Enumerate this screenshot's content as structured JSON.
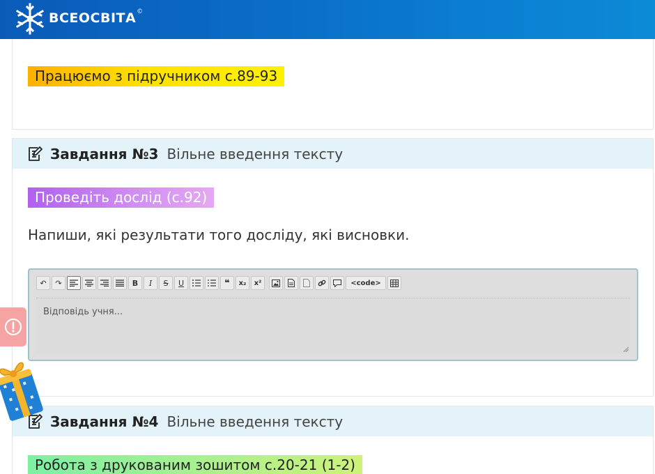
{
  "header": {
    "brand": "ВСЕОСВІТА",
    "copyright": "©",
    "logo_icon": "snowflake-icon"
  },
  "section_top": {
    "highlight": "Працюємо з підручником с.89-93"
  },
  "task3": {
    "number": "Завдання №3",
    "type": "Вільне введення тексту",
    "icon": "edit-note-icon",
    "highlight": "Проведіть дослід (с.92)",
    "text": "Напиши, які результати того досліду, які висновки.",
    "editor": {
      "placeholder": "Відповідь учня...",
      "toolbar": [
        "undo",
        "redo",
        "align-left",
        "align-center",
        "align-right",
        "justify",
        "bold",
        "italic",
        "strikethrough",
        "underline",
        "bullet-list",
        "numbered-list",
        "quote",
        "subscript",
        "superscript",
        "image",
        "file",
        "document",
        "link",
        "comment",
        "code",
        "table"
      ],
      "bold_label": "B",
      "italic_label": "I",
      "strike_label": "S",
      "underline_label": "U",
      "quote_label": "❝",
      "sub_label": "x₂",
      "sup_label": "x²",
      "code_label": "<code>"
    }
  },
  "task4": {
    "number": "Завдання №4",
    "type": "Вільне введення тексту",
    "icon": "edit-note-icon",
    "highlight": "Робота з друкованим зошитом с.20-21 (1-2)"
  },
  "side": {
    "alert_icon": "exclamation-icon",
    "gift_icon": "gift-icon"
  },
  "colors": {
    "header_gradient_start": "#0a5bb8",
    "header_gradient_end": "#0c8bd6",
    "task_header_bg": "#e4f3fa",
    "highlight_orange": "#ffd200",
    "highlight_purple": "#c078ef",
    "highlight_green": "#a8f090",
    "alert_tab": "#f5a3a3"
  }
}
